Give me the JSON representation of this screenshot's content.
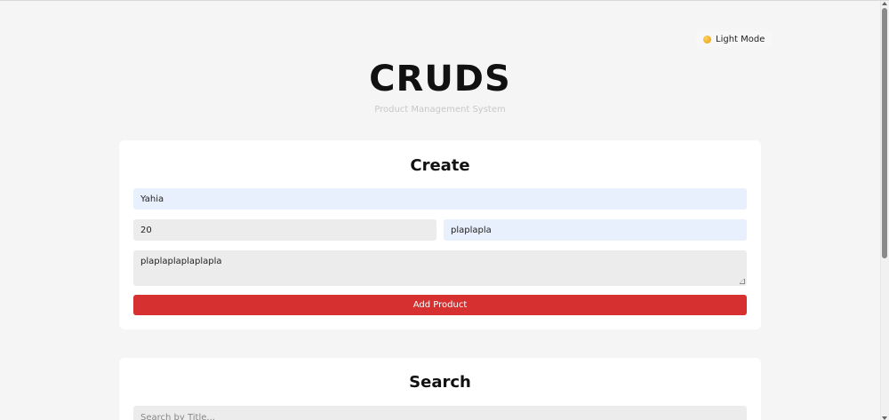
{
  "header": {
    "theme_toggle_label": "Light Mode",
    "title": "CRUDS",
    "subtitle": "Product Management System"
  },
  "create": {
    "heading": "Create",
    "title_value": "Yahia",
    "price_value": "20",
    "category_value": "plaplapla",
    "description_value": "plaplaplaplaplapla",
    "add_button_label": "Add Product"
  },
  "search": {
    "heading": "Search",
    "placeholder": "Search by Title..."
  },
  "colors": {
    "accent": "#d63031",
    "autofill": "#e8f0fe",
    "background": "#f5f5f5"
  }
}
